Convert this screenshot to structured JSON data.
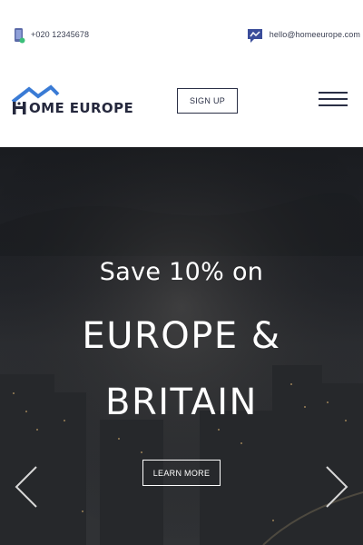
{
  "topbar": {
    "phone": "+020 12345678",
    "phone_icon": "mobile-phone-icon",
    "email": "hello@homeeurope.com",
    "email_icon": "chat-bubble-icon"
  },
  "navbar": {
    "logo_text": "OME EUROPE",
    "logo_icon": "house-roof-logo",
    "signup_label": "SIGN UP",
    "menu_icon": "hamburger-menu-icon"
  },
  "hero": {
    "subtitle": "Save 10% on",
    "title": "EUROPE & BRITAIN",
    "cta_label": "LEARN MORE",
    "prev_icon": "chevron-left-icon",
    "next_icon": "chevron-right-icon"
  },
  "colors": {
    "brand_dark": "#2a2f45",
    "logo_blue": "#3a7bd5",
    "hero_overlay": "#2b2d31",
    "white": "#ffffff"
  }
}
